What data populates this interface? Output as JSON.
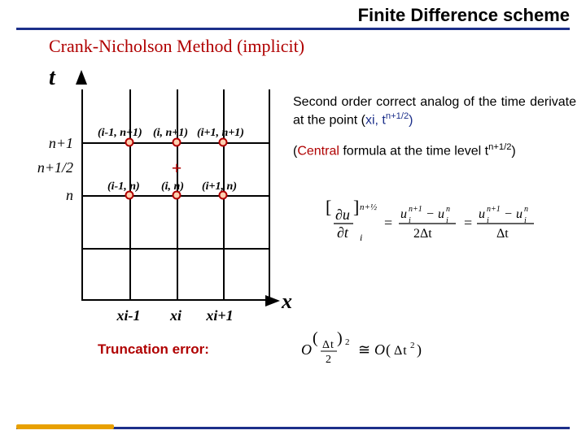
{
  "header": {
    "title": "Finite Difference scheme",
    "subtitle": "Crank-Nicholson Method (implicit)"
  },
  "axes": {
    "t": "t",
    "x": "x",
    "y_labels": [
      "n+1",
      "n+1/2",
      "n"
    ],
    "x_labels": [
      "xi-1",
      "xi",
      "xi+1"
    ]
  },
  "stencil": {
    "top_row": [
      "(i-1, n+1)",
      "(i, n+1)",
      "(i+1, n+1)"
    ],
    "bottom_row": [
      "(i-1, n)",
      "(i, n)",
      "(i+1, n)"
    ],
    "center_symbol": "+"
  },
  "explain": {
    "p1_a": "Second order correct analog of the time derivate at the point (",
    "p1_xi": "xi",
    "p1_sep": ", ",
    "p1_t": "t",
    "p1_exp": "n+1/2",
    "p1_b": ")",
    "p2_a": "(",
    "p2_central": "Central",
    "p2_b": " formula at the time level ",
    "p2_t": "t",
    "p2_exp": "n+1/2",
    "p2_c": ")"
  },
  "equation": {
    "lhs_sup": "n+½",
    "lhs_sub": "i",
    "rhs1_num_sup1": "n+1",
    "rhs1_num_sup2": "n",
    "rhs_sub": "i",
    "denom1": "2Δt",
    "denom2": "Δt"
  },
  "truncation": {
    "label": "Truncation error:",
    "expr": "O(Δt/2)² ≅ O(Δt²)"
  }
}
